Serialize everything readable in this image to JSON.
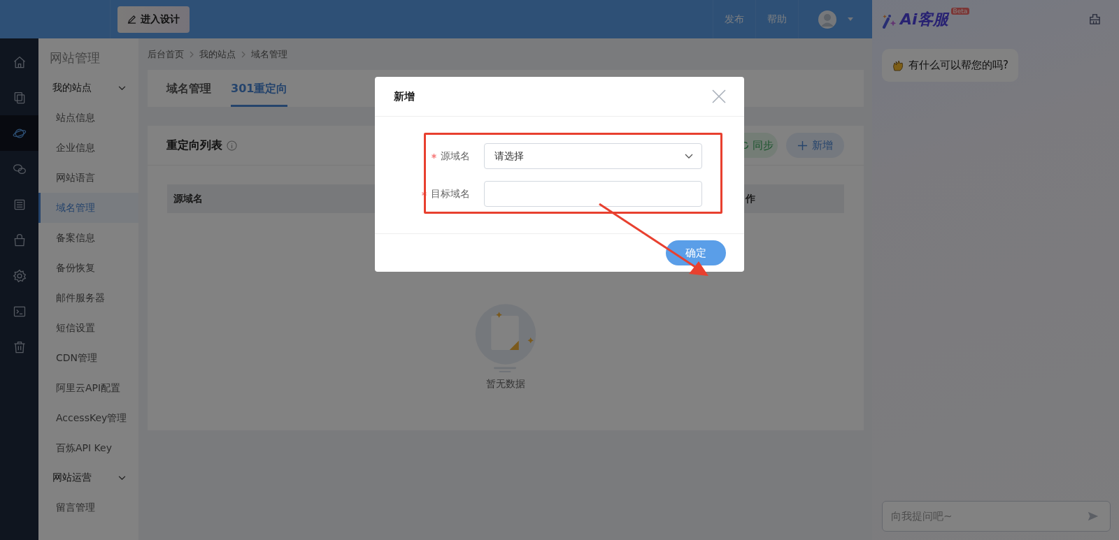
{
  "topbar": {
    "design_button": "进入设计",
    "links": [
      "发布",
      "帮助"
    ]
  },
  "rail": [
    {
      "kind": "home",
      "selected": false
    },
    {
      "kind": "pages",
      "selected": false
    },
    {
      "kind": "planet",
      "selected": true
    },
    {
      "kind": "chat",
      "selected": false
    },
    {
      "kind": "list",
      "selected": false
    },
    {
      "kind": "bag",
      "selected": false
    },
    {
      "kind": "gear",
      "selected": false
    },
    {
      "kind": "terminal",
      "selected": false
    },
    {
      "kind": "trash",
      "selected": false
    }
  ],
  "menu": {
    "title": "网站管理",
    "groups": [
      {
        "label": "我的站点",
        "expanded": true,
        "items": [
          {
            "label": "站点信息",
            "selected": false
          },
          {
            "label": "企业信息",
            "selected": false
          },
          {
            "label": "网站语言",
            "selected": false
          },
          {
            "label": "域名管理",
            "selected": true
          },
          {
            "label": "备案信息",
            "selected": false
          },
          {
            "label": "备份恢复",
            "selected": false
          },
          {
            "label": "邮件服务器",
            "selected": false
          },
          {
            "label": "短信设置",
            "selected": false
          },
          {
            "label": "CDN管理",
            "selected": false
          },
          {
            "label": "阿里云API配置",
            "selected": false
          },
          {
            "label": "AccessKey管理",
            "selected": false
          },
          {
            "label": "百炼API Key",
            "selected": false
          }
        ]
      },
      {
        "label": "网站运营",
        "expanded": true,
        "items": [
          {
            "label": "留言管理",
            "selected": false
          }
        ]
      }
    ]
  },
  "breadcrumb": [
    "后台首页",
    "我的站点",
    "域名管理"
  ],
  "tabs": [
    {
      "label": "域名管理",
      "selected": false
    },
    {
      "label": "301重定向",
      "selected": true
    }
  ],
  "list": {
    "title": "重定向列表",
    "buttons": [
      {
        "kind": "sync",
        "label": "同步"
      },
      {
        "kind": "add",
        "label": "新增"
      }
    ],
    "columns": [
      "源域名",
      "作"
    ],
    "empty_text": "暂无数据"
  },
  "dialog": {
    "title": "新增",
    "fields": [
      {
        "kind": "select",
        "label": "源域名",
        "required": true,
        "placeholder": "请选择"
      },
      {
        "kind": "input",
        "label": "目标域名",
        "required": true
      }
    ],
    "confirm": "确定"
  },
  "ai": {
    "title": "Ai客服",
    "badge": "Beta",
    "greeting": "有什么可以帮您的吗?",
    "chat_input": {
      "placeholder": "向我提问吧~"
    }
  }
}
